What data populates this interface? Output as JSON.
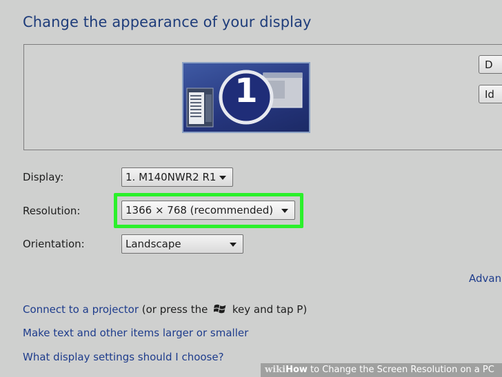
{
  "window": {
    "title": "Change the appearance of your display"
  },
  "preview": {
    "monitor_number": "1",
    "side_buttons": [
      {
        "label": "D"
      },
      {
        "label": "Id"
      }
    ]
  },
  "fields": {
    "display": {
      "label": "Display:",
      "value": "1. M140NWR2 R1"
    },
    "resolution": {
      "label": "Resolution:",
      "value": "1366 × 768 (recommended)"
    },
    "orientation": {
      "label": "Orientation:",
      "value": "Landscape"
    }
  },
  "advanced_link": "Advan",
  "links": {
    "projector": {
      "link_text": "Connect to a projector",
      "before_key": "(or press the",
      "after_key": "key and tap P)"
    },
    "text_size": "Make text and other items larger or smaller",
    "which_settings": "What display settings should I choose?"
  },
  "watermark": {
    "brand": "wiki",
    "how": "How",
    "rest": " to Change the Screen Resolution on a PC"
  },
  "colors": {
    "highlight": "#2bf02b",
    "link": "#1e3c8c",
    "title": "#1e3c7a"
  },
  "icons": {
    "windows_key": "windows-logo-icon",
    "dropdown": "chevron-down-icon"
  }
}
